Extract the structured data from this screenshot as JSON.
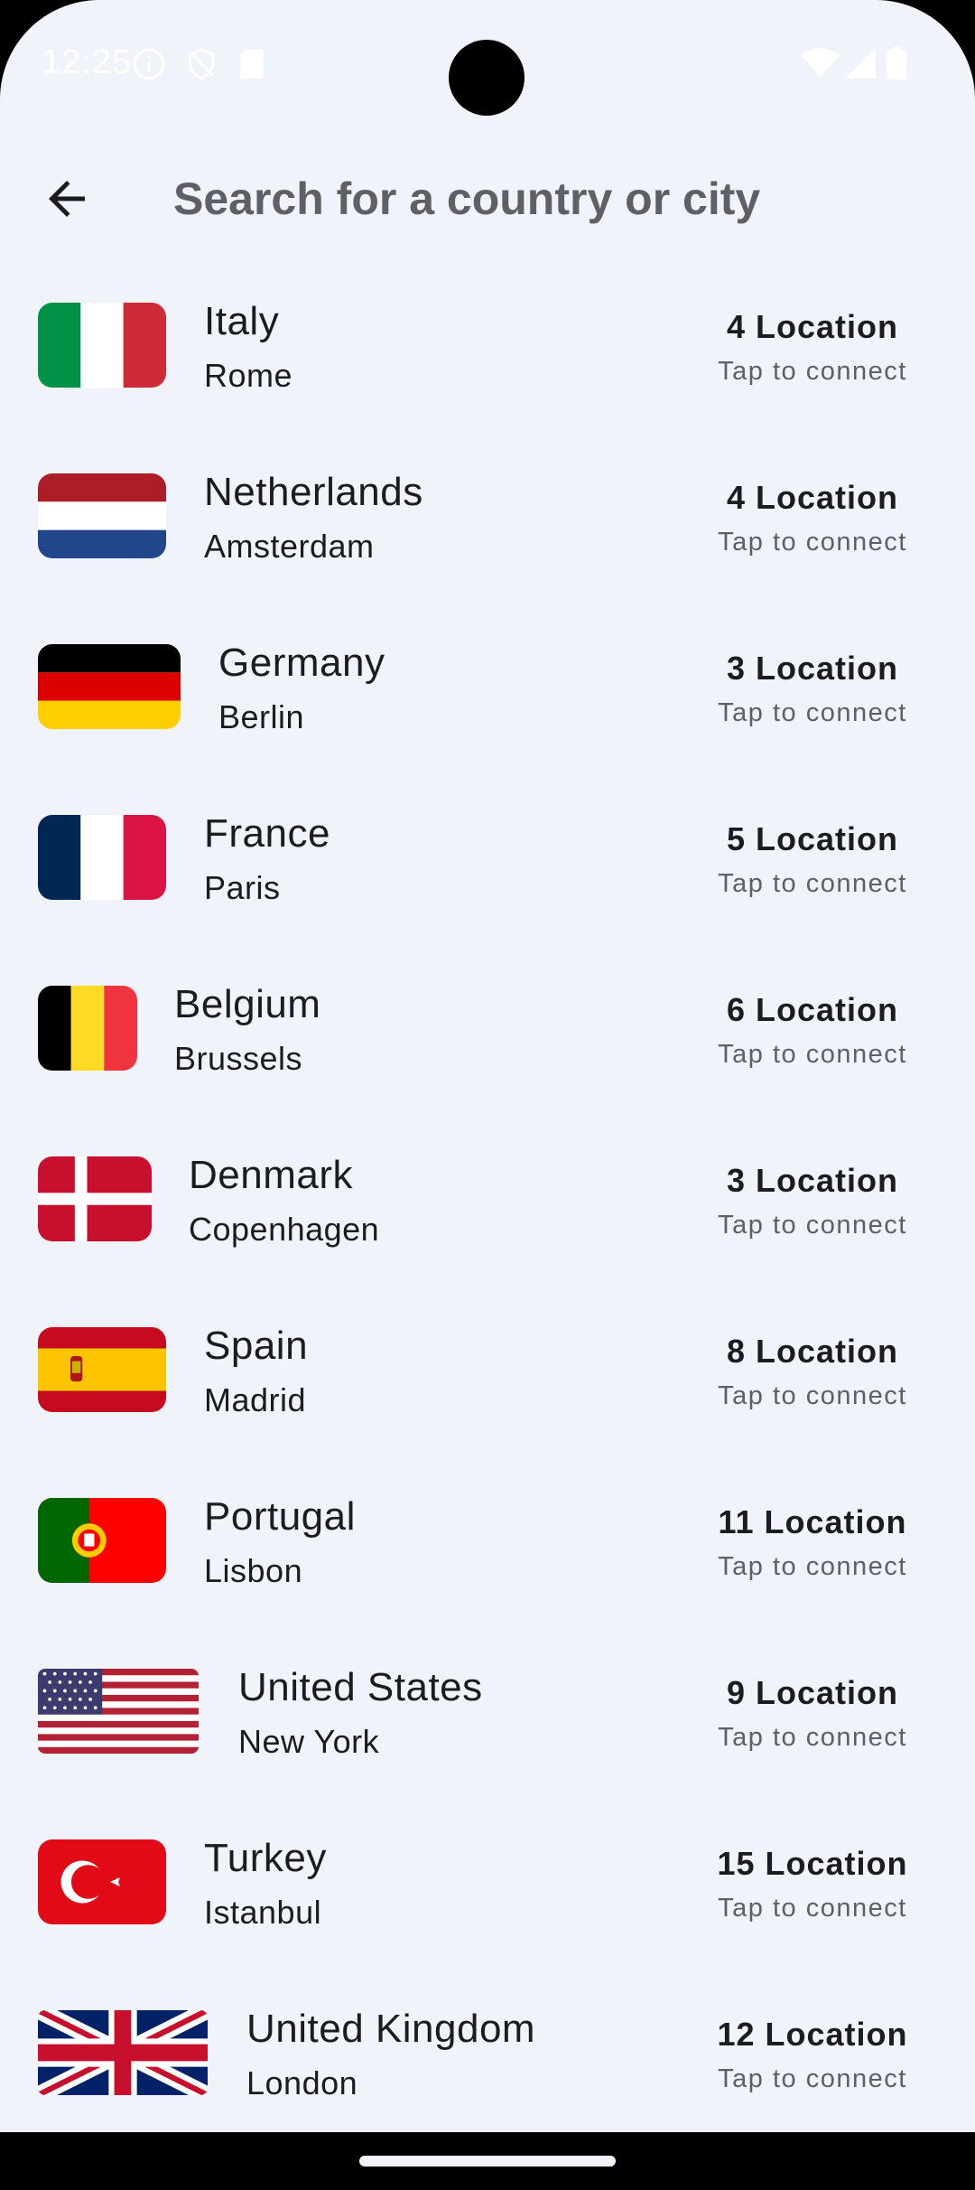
{
  "status_bar": {
    "time": "12:25"
  },
  "search": {
    "placeholder": "Search for a country or city"
  },
  "countries": [
    {
      "country": "Italy",
      "city": "Rome",
      "locations": "4 Location",
      "action": "Tap to connect"
    },
    {
      "country": "Netherlands",
      "city": "Amsterdam",
      "locations": "4 Location",
      "action": "Tap to connect"
    },
    {
      "country": "Germany",
      "city": "Berlin",
      "locations": "3 Location",
      "action": "Tap to connect"
    },
    {
      "country": "France",
      "city": "Paris",
      "locations": "5 Location",
      "action": "Tap to connect"
    },
    {
      "country": "Belgium",
      "city": "Brussels",
      "locations": "6 Location",
      "action": "Tap to connect"
    },
    {
      "country": "Denmark",
      "city": "Copenhagen",
      "locations": "3 Location",
      "action": "Tap to connect"
    },
    {
      "country": "Spain",
      "city": "Madrid",
      "locations": "8 Location",
      "action": "Tap to connect"
    },
    {
      "country": "Portugal",
      "city": "Lisbon",
      "locations": "11 Location",
      "action": "Tap to connect"
    },
    {
      "country": "United States",
      "city": "New York",
      "locations": "9 Location",
      "action": "Tap to connect"
    },
    {
      "country": "Turkey",
      "city": "Istanbul",
      "locations": "15 Location",
      "action": "Tap to connect"
    },
    {
      "country": "United Kingdom",
      "city": "London",
      "locations": "12 Location",
      "action": "Tap to connect"
    }
  ],
  "icons": {
    "back": "arrow-back-icon",
    "status": [
      "info-icon",
      "shield-icon",
      "sd-card-icon",
      "wifi-icon",
      "signal-icon",
      "battery-icon"
    ]
  },
  "colors": {
    "background": "#f0f3f9",
    "text": "#1b1c1f",
    "secondary_text": "#5e6068"
  }
}
